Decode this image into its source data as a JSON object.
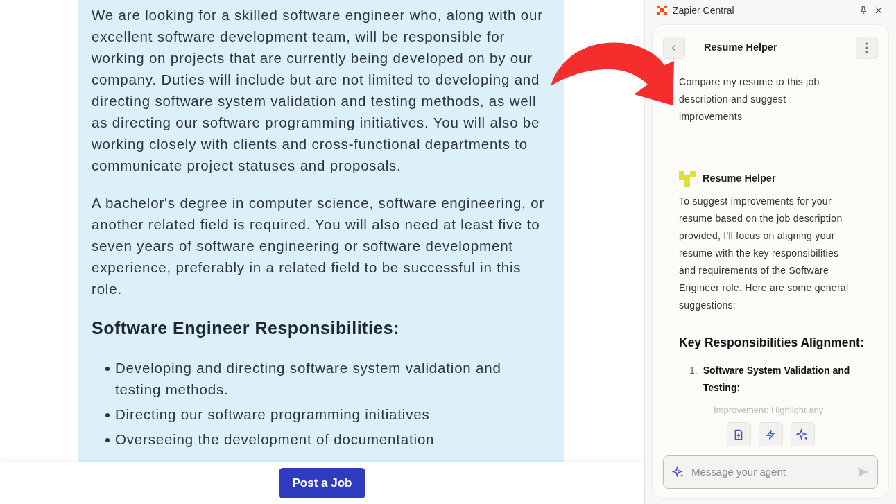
{
  "job_posting": {
    "paragraphs": [
      "We are looking for a skilled software engineer who, along with our excellent software development team, will be responsible for working on projects that are currently being developed on by our company. Duties will include but are not limited to developing and directing software system validation and testing methods, as well as directing our software programming initiatives. You will also be working closely with clients and cross-functional departments to communicate project statuses and proposals.",
      "A bachelor's degree in computer science, software engineering, or another related field is required. You will also need at least five to seven years of software engineering or software development experience, preferably in a related field to be successful in this role."
    ],
    "heading": "Software Engineer Responsibilities:",
    "bullets": [
      "Developing and directing software system validation and testing methods.",
      "Directing our software programming initiatives",
      "Overseeing the development of documentation"
    ],
    "button": "Post a Job"
  },
  "side_panel": {
    "title": "Zapier Central",
    "agent_header": {
      "title": "Resume Helper"
    },
    "user_message": "Compare my resume to this job description and suggest improvements",
    "agent_reply": {
      "name": "Resume Helper",
      "text": "To suggest improvements for your resume based on the job description provided, I'll focus on aligning your resume with the key responsibilities and requirements of the Software Engineer role. Here are some general suggestions:",
      "heading": "Key Responsibilities Alignment:",
      "items": [
        {
          "number": "1.",
          "title": "Software System Validation and Testing:"
        }
      ],
      "faded_text": "Improvement: Highlight any"
    },
    "composer": {
      "placeholder": "Message your agent"
    }
  }
}
